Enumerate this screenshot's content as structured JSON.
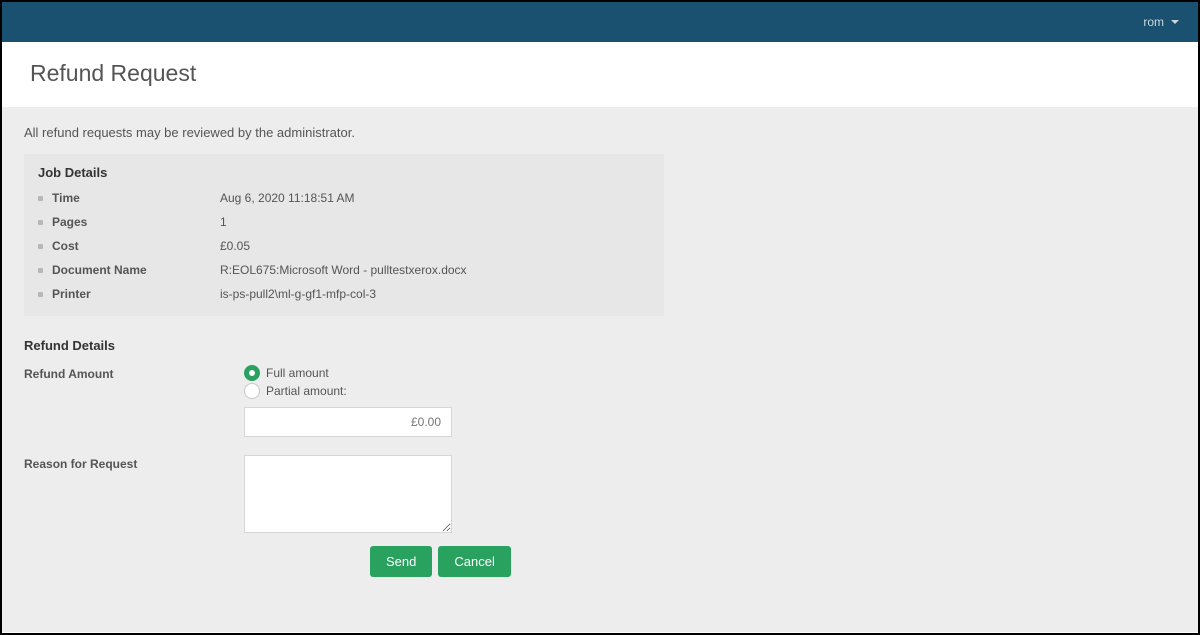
{
  "header": {
    "user_label": "rom"
  },
  "page": {
    "title": "Refund Request",
    "intro": "All refund requests may be reviewed by the administrator."
  },
  "job_details": {
    "section_title": "Job Details",
    "rows": {
      "time": {
        "label": "Time",
        "value": "Aug 6, 2020 11:18:51 AM"
      },
      "pages": {
        "label": "Pages",
        "value": "1"
      },
      "cost": {
        "label": "Cost",
        "value": "£0.05"
      },
      "doc": {
        "label": "Document Name",
        "value": "R:EOL675:Microsoft Word - pulltestxerox.docx"
      },
      "printer": {
        "label": "Printer",
        "value": "is-ps-pull2\\ml-g-gf1-mfp-col-3"
      }
    }
  },
  "refund_details": {
    "section_title": "Refund Details",
    "amount_label": "Refund Amount",
    "option_full": "Full amount",
    "option_partial": "Partial amount:",
    "partial_placeholder": "£0.00",
    "reason_label": "Reason for Request"
  },
  "buttons": {
    "send": "Send",
    "cancel": "Cancel"
  }
}
